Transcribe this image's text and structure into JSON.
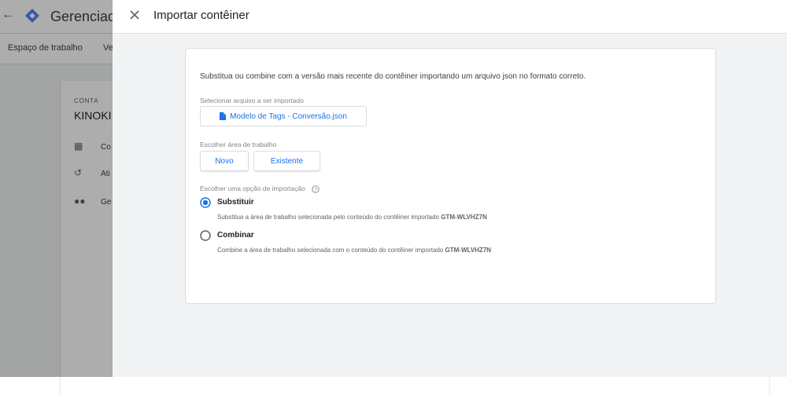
{
  "background": {
    "title": "Gerenciador",
    "nav": [
      "Espaço de trabalho",
      "Ve"
    ],
    "account_label": "CONTA",
    "account_name": "KINOKI",
    "rows": [
      "Co",
      "Ati",
      "Ge"
    ]
  },
  "dialog": {
    "title": "Importar contêiner",
    "intro": "Substitua ou combine com a versão mais recente do contêiner importando um arquivo json no formato correto.",
    "file_section_label": "Selecionar arquivo a ser importado",
    "file_name": "Modelo de Tags - Conversão.json",
    "workspace_label": "Escolher área de trabalho",
    "workspace_new": "Novo",
    "workspace_existing": "Existente",
    "import_option_label": "Escolher uma opção de importação",
    "options": [
      {
        "label": "Substituir",
        "desc": "Substitua a área de trabalho selecionada pelo conteúdo do contêiner importado",
        "container": "GTM-WLVHZ7N",
        "selected": true
      },
      {
        "label": "Combinar",
        "desc": "Combine a área de trabalho selecionada com o conteúdo do contêiner importado",
        "container": "GTM-WLVHZ7N",
        "selected": false
      }
    ]
  },
  "colors": {
    "accent": "#1a73e8",
    "scrim": "rgba(0,0,0,0.32)",
    "panel_bg": "#f1f3f4"
  },
  "icons": [
    "back-arrow-icon",
    "gtm-logo-icon",
    "building-icon",
    "history-icon",
    "people-icon",
    "close-icon",
    "file-icon",
    "help-icon",
    "radio-checked-icon",
    "radio-unchecked-icon"
  ]
}
